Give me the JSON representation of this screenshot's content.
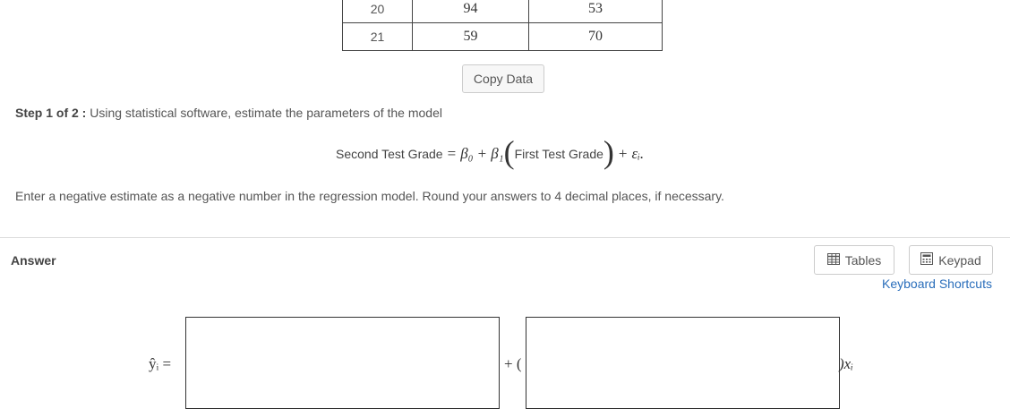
{
  "table": {
    "rows": [
      {
        "num": "20",
        "first": "94",
        "second": "53"
      },
      {
        "num": "21",
        "first": "59",
        "second": "70"
      }
    ]
  },
  "copy_button": "Copy Data",
  "step": {
    "prefix": "Step 1 of 2 :",
    "text": "Using statistical software, estimate the parameters of the model"
  },
  "model": {
    "lhs": "Second Test Grade",
    "eq": "=",
    "b0": "β₀",
    "plus1": "+",
    "b1": "β₁",
    "first": "First Test Grade",
    "plus2": "+",
    "eps": "εᵢ",
    "period": "."
  },
  "instruction": "Enter a negative estimate as a negative number in the regression model. Round your answers to 4 decimal places, if necessary.",
  "answer": {
    "label": "Answer",
    "tables_button": "Tables",
    "keypad_button": "Keypad",
    "shortcuts_link": "Keyboard Shortcuts",
    "yhat": "ŷᵢ =",
    "plus_paren": "+ (",
    "close_x": ")xᵢ",
    "intercept_value": "",
    "slope_value": ""
  },
  "icons": {
    "tables": "table-grid-icon",
    "keypad": "calculator-icon"
  },
  "colors": {
    "link": "#2a6ebb",
    "border": "#333333"
  }
}
